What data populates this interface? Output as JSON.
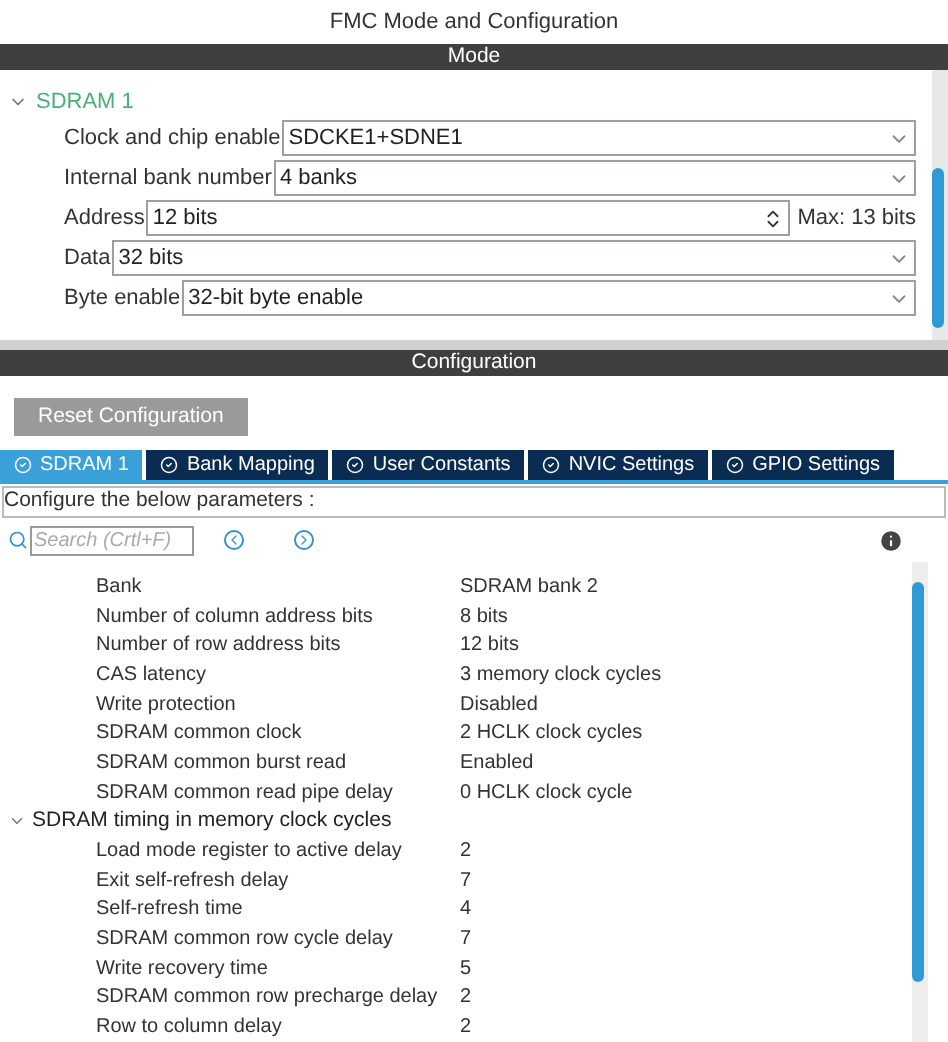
{
  "window": {
    "title": "FMC Mode and Configuration"
  },
  "mode": {
    "header": "Mode",
    "group": {
      "label": "SDRAM 1",
      "expanded": true
    },
    "fields": [
      {
        "kind": "select",
        "label": "Clock and chip enable",
        "value": "SDCKE1+SDNE1"
      },
      {
        "kind": "select",
        "label": "Internal bank number",
        "value": "4 banks"
      },
      {
        "kind": "spinner",
        "label": "Address",
        "value": "12 bits",
        "note": "Max: 13 bits"
      },
      {
        "kind": "select",
        "label": "Data",
        "value": "32 bits"
      },
      {
        "kind": "select",
        "label": "Byte enable",
        "value": "32-bit byte enable"
      }
    ]
  },
  "configuration": {
    "header": "Configuration",
    "reset_button": "Reset Configuration",
    "tabs": [
      {
        "label": "SDRAM 1",
        "selected": true
      },
      {
        "label": "Bank Mapping",
        "selected": false
      },
      {
        "label": "User Constants",
        "selected": false
      },
      {
        "label": "NVIC Settings",
        "selected": false
      },
      {
        "label": "GPIO Settings",
        "selected": false
      }
    ],
    "hint": "Configure the below parameters :",
    "search": {
      "placeholder": "Search (Crtl+F)"
    },
    "parameters": [
      {
        "name": "Bank",
        "value": "SDRAM bank 2"
      },
      {
        "name": "Number of column address bits",
        "value": "8 bits"
      },
      {
        "name": "Number of row address bits",
        "value": "12 bits"
      },
      {
        "name": "CAS latency",
        "value": "3 memory clock cycles"
      },
      {
        "name": "Write protection",
        "value": "Disabled"
      },
      {
        "name": "SDRAM common clock",
        "value": "2 HCLK clock cycles"
      },
      {
        "name": "SDRAM common burst read",
        "value": "Enabled"
      },
      {
        "name": "SDRAM common read pipe delay",
        "value": "0 HCLK clock cycle"
      }
    ],
    "groups": [
      {
        "label": "SDRAM timing in memory clock cycles",
        "expanded": true,
        "parameters": [
          {
            "name": "Load mode register to active delay",
            "value": "2"
          },
          {
            "name": "Exit self-refresh delay",
            "value": "7"
          },
          {
            "name": "Self-refresh time",
            "value": "4"
          },
          {
            "name": "SDRAM common row cycle delay",
            "value": "7"
          },
          {
            "name": "Write recovery time",
            "value": "5"
          },
          {
            "name": "SDRAM common row precharge delay",
            "value": "2"
          },
          {
            "name": "Row to column delay",
            "value": "2"
          }
        ]
      }
    ]
  }
}
